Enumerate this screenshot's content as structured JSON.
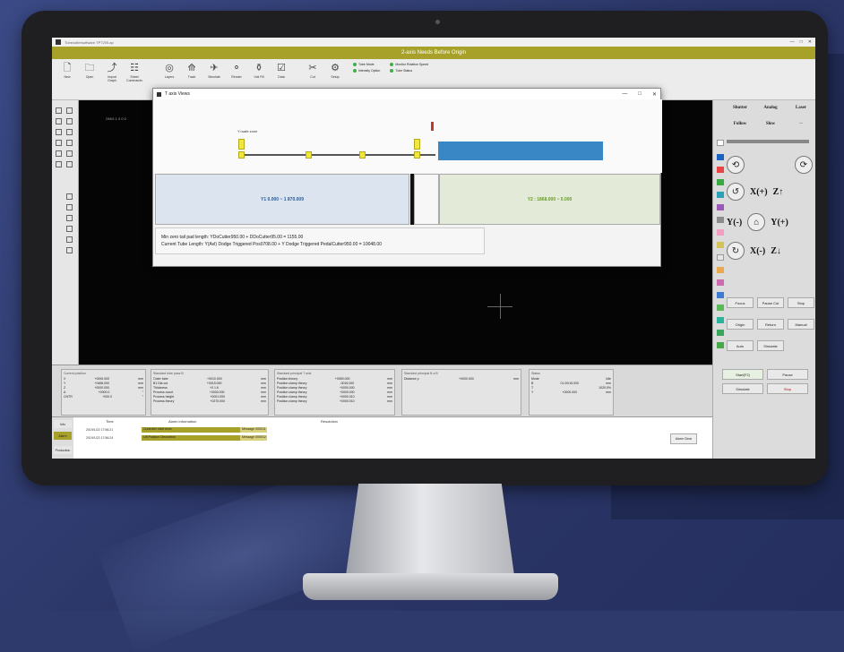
{
  "window": {
    "title_small": "Tubecuttersoftware TP7200.ap",
    "app_title": "2-axis Needs Before Origin",
    "controls": [
      "—",
      "□",
      "✕"
    ]
  },
  "ribbon": [
    {
      "label": "New",
      "icon": "new-file-icon",
      "glyph": "🗋"
    },
    {
      "label": "Open",
      "icon": "open-folder-icon",
      "glyph": "🗀"
    },
    {
      "label": "Import Graph",
      "icon": "import-icon",
      "glyph": "⤴"
    },
    {
      "label": "Sheet Commands",
      "icon": "sheet-icon",
      "glyph": "☷"
    },
    {
      "label": "Layers",
      "icon": "layers-icon",
      "glyph": "◎"
    },
    {
      "label": "Track",
      "icon": "track-icon",
      "glyph": "⟰"
    },
    {
      "label": "Simulate",
      "icon": "simulate-icon",
      "glyph": "✈"
    },
    {
      "label": "Render",
      "icon": "render-icon",
      "glyph": "⚬"
    },
    {
      "label": "Vial Fill",
      "icon": "vial-icon",
      "glyph": "⚱"
    },
    {
      "label": "Data",
      "icon": "data-icon",
      "glyph": "☑"
    },
    {
      "label": "Cut",
      "icon": "scissors-icon",
      "glyph": "✂"
    },
    {
      "label": "Setup",
      "icon": "gear-icon",
      "glyph": "⚙"
    }
  ],
  "status": {
    "left": [
      "Tube Mode",
      "Intensity Option"
    ],
    "right": [
      "Monitor Rotation Speed",
      "Tube Status"
    ]
  },
  "dialog": {
    "title": "T axis Views",
    "tube_label": "Y=safe zone",
    "y_left": "Y1 0.000 ~ 1 870.009",
    "y_right": "Y2 : 1868.000 ~ 0.000",
    "info_line1": "Min zero tail pad length: YDoCutter950.00 + DDoCutter95.00 = 1155.00",
    "info_line2": "Current Tube Length: Y(Avl) Dodge Triggered Pos0708.00 + Y Dodge Triggered PedalCutter950.00 = 10048.00"
  },
  "canvas": {
    "coord": "OMG 1 0 0 0"
  },
  "right_panel": {
    "top_row": [
      "Shutter",
      "Analog",
      "Laser"
    ],
    "second_row": [
      "Follow",
      "Slow",
      "◦◦"
    ],
    "jog_labels": [
      "X(-)",
      "Y(-)",
      "Y(+)",
      "X(+)",
      "Z↑",
      "Z↓"
    ],
    "buttons": [
      "Focus",
      "Pause Cut",
      "Stop",
      "Origin",
      "Return",
      "Manual",
      "Auto",
      "Simulate"
    ],
    "cut_label": "Start(F2)",
    "pause_label": "Pause",
    "stop_label": "Stop",
    "check_label": "Simulate"
  },
  "bottom": {
    "current_position": {
      "title": "Current position",
      "rows": [
        [
          "X",
          "+0000.000",
          "mm"
        ],
        [
          "Y",
          "+0466.000",
          "mm"
        ],
        [
          "Z",
          "+0000.000",
          "mm"
        ],
        [
          "A",
          "+0000.0",
          "°"
        ],
        [
          "CNTR",
          "+000.0",
          "°"
        ]
      ]
    },
    "process": {
      "title": "Standard tube pass B",
      "rows": [
        [
          "Outer tube",
          "+0010.000",
          "mm"
        ],
        [
          "B1 Dia cut",
          "+0015.000",
          "mm"
        ],
        [
          "Thickness",
          "+0 1.6",
          "mm"
        ],
        [
          "Process count",
          "+0000.000",
          "mm"
        ],
        [
          "Process height",
          "+0001.000",
          "mm"
        ],
        [
          "Process theory",
          "+0270.000",
          "mm"
        ]
      ]
    },
    "axis": {
      "title": "Standard principal T axis",
      "rows": [
        [
          "Position theory",
          "+0050.000",
          "mm"
        ],
        [
          "Position clamp theory",
          "-0015.000",
          "mm"
        ],
        [
          "Position clamp theory",
          "+0000.000",
          "mm"
        ],
        [
          "Position clamp theory",
          "+0000.000",
          "mm"
        ],
        [
          "Position clamp theory",
          "+0000.010",
          "mm"
        ],
        [
          "Position clamp theory",
          "+0000.010",
          "mm"
        ]
      ]
    },
    "distance": {
      "title": "Standard principal B a B",
      "rows": [
        [
          "Distance p",
          "+0000.000",
          "mm"
        ]
      ]
    },
    "status": {
      "title": "Status",
      "rows": [
        [
          "Mode",
          "Idle"
        ],
        [
          "B",
          "01.00/15.000",
          "mm"
        ],
        [
          "T",
          "1020.0%",
          ""
        ],
        [
          "Y",
          "+0000.000",
          "mm"
        ]
      ]
    }
  },
  "log": {
    "tabs": [
      "Info",
      "Alarm",
      "Production"
    ],
    "headers": [
      "Time",
      "Alarm information",
      "Resolution"
    ],
    "rows": [
      {
        "time": "2019/1/22 17:56:21",
        "info": "Controller start done",
        "res": "Message 000011"
      },
      {
        "time": "2019/1/22 17:56:24",
        "info": "Lift Position Decoration",
        "res": "Message 000012"
      }
    ],
    "clear_label": "Alarm Clear"
  }
}
